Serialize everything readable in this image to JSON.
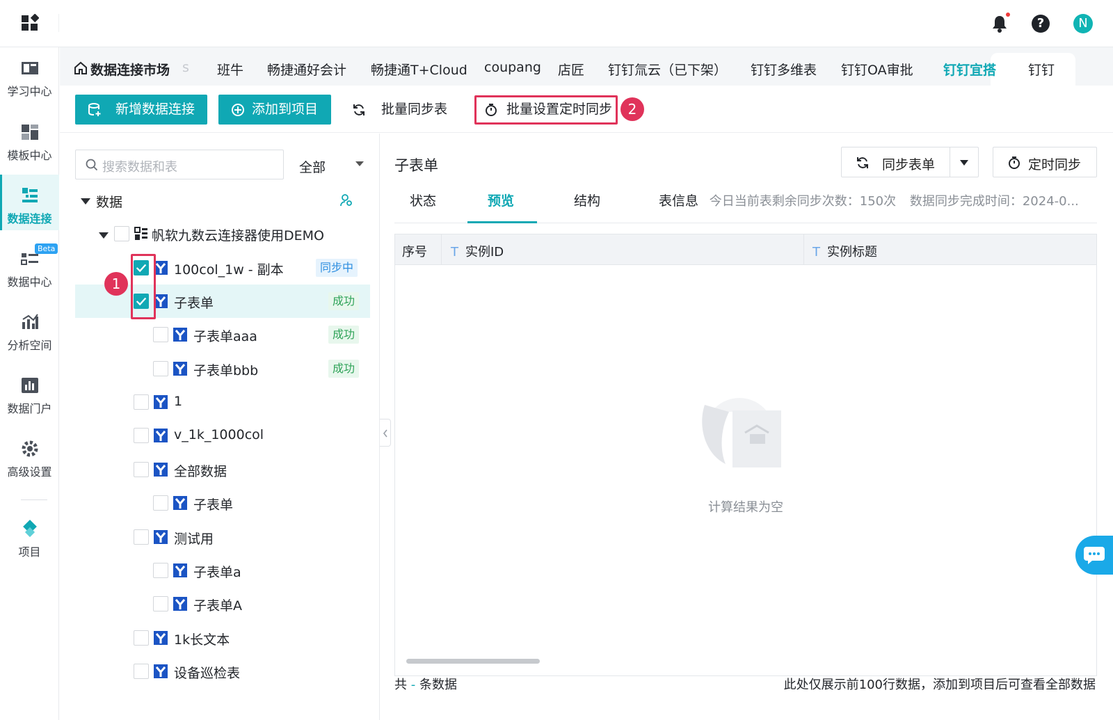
{
  "header": {
    "user_initial": "N",
    "help_label": "?"
  },
  "sidebar": {
    "items": [
      {
        "label": "学习中心",
        "icon": "book-icon"
      },
      {
        "label": "模板中心",
        "icon": "template-icon"
      },
      {
        "label": "数据连接",
        "icon": "data-connect-icon",
        "active": true
      },
      {
        "label": "数据中心",
        "icon": "data-center-icon",
        "badge": "Beta"
      },
      {
        "label": "分析空间",
        "icon": "analysis-icon"
      },
      {
        "label": "数据门户",
        "icon": "portal-icon"
      },
      {
        "label": "高级设置",
        "icon": "gear-icon"
      },
      {
        "label": "项目",
        "icon": "project-icon"
      }
    ]
  },
  "tabs": {
    "home": "数据连接市场",
    "faded": "s",
    "items": [
      "班牛",
      "畅捷通好会计",
      "畅捷通T+Cloud",
      "coupang",
      "店匠",
      "钉钉氚云（已下架）",
      "钉钉多维表",
      "钉钉OA审批",
      "钉钉宜搭",
      "钉钉"
    ],
    "active": "钉钉宜搭"
  },
  "toolbar": {
    "new_connection": "新增数据连接",
    "add_to_project": "添加到项目",
    "batch_sync": "批量同步表",
    "batch_timer": "批量设置定时同步",
    "callout_1": "1",
    "callout_2": "2"
  },
  "left": {
    "search_placeholder": "搜索数据和表",
    "filter": "全部",
    "root": "数据",
    "connector": "帆软九数云连接器使用DEMO",
    "rows": [
      {
        "label": "100col_1w - 副本",
        "status": "同步中",
        "checked": true
      },
      {
        "label": "子表单",
        "status": "成功",
        "checked": true,
        "selected": true
      },
      {
        "label": "子表单aaa",
        "status": "成功"
      },
      {
        "label": "子表单bbb",
        "status": "成功"
      },
      {
        "label": "1"
      },
      {
        "label": "v_1k_1000col"
      },
      {
        "label": "全部数据"
      },
      {
        "label": "子表单"
      },
      {
        "label": "测试用"
      },
      {
        "label": "子表单a"
      },
      {
        "label": "子表单A"
      },
      {
        "label": "1k长文本"
      },
      {
        "label": "设备巡检表"
      }
    ]
  },
  "main": {
    "title": "子表单",
    "sync_button": "同步表单",
    "timer_button": "定时同步",
    "subtabs": [
      "状态",
      "预览",
      "结构"
    ],
    "active_subtab": "预览",
    "info_label": "表信息",
    "info_text": "今日当前表剩余同步次数：150次",
    "info_time": "数据同步完成时间：2024-0...",
    "columns": [
      "序号",
      "实例ID",
      "实例标题"
    ],
    "column_type": "T",
    "empty_text": "计算结果为空",
    "footer_prefix": "共",
    "footer_dash": "-",
    "footer_suffix": "条数据",
    "footer_note": "此处仅展示前100行数据，添加到项目后可查看全部数据"
  },
  "colors": {
    "accent": "#10a8b4",
    "highlight": "#e0335a",
    "success": "#2fa358",
    "syncing": "#2d8ee0"
  }
}
